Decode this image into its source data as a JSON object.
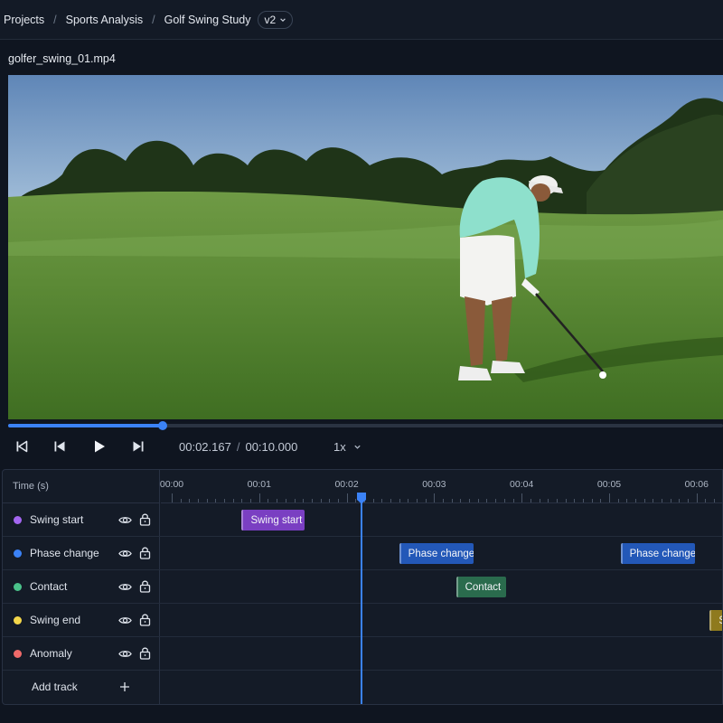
{
  "breadcrumb": {
    "items": [
      "Projects",
      "Sports Analysis",
      "Golf Swing Study"
    ],
    "separator": "/",
    "version": "v2"
  },
  "video": {
    "filename": "golfer_swing_01.mp4",
    "progress_fraction": 0.2167
  },
  "player": {
    "current_time": "00:02.167",
    "separator": "/",
    "duration": "00:10.000",
    "speed": "1x",
    "controls": [
      "skip-to-start-icon",
      "step-back-icon",
      "play-icon",
      "step-forward-icon"
    ]
  },
  "timeline": {
    "header_label": "Time (s)",
    "ticks": [
      "00:00",
      "00:01",
      "00:02",
      "00:03",
      "00:04",
      "00:05",
      "00:06"
    ],
    "playhead_seconds": 2.167,
    "tracks": [
      {
        "name": "Swing start",
        "color": "#a366f0",
        "clips": [
          {
            "label": "Swing start",
            "start": 0.8,
            "end": 1.52,
            "color": "#7a3fc2"
          }
        ]
      },
      {
        "name": "Phase change",
        "color": "#3b82f6",
        "clips": [
          {
            "label": "Phase change",
            "start": 2.6,
            "end": 3.45,
            "color": "#2358b8"
          },
          {
            "label": "Phase change",
            "start": 5.13,
            "end": 5.98,
            "color": "#2358b8"
          }
        ]
      },
      {
        "name": "Contact",
        "color": "#4ac28a",
        "clips": [
          {
            "label": "Contact",
            "start": 3.25,
            "end": 3.82,
            "color": "#2a6b4d"
          }
        ]
      },
      {
        "name": "Swing end",
        "color": "#f3d64a",
        "clips": [
          {
            "label": "Swing end",
            "start": 6.15,
            "end": 6.9,
            "color": "#8f7a1e"
          }
        ]
      },
      {
        "name": "Anomaly",
        "color": "#ef6a6a",
        "clips": []
      }
    ],
    "add_track_label": "Add track"
  },
  "colors": {
    "accent": "#3b82f6",
    "background": "#0f1520"
  }
}
